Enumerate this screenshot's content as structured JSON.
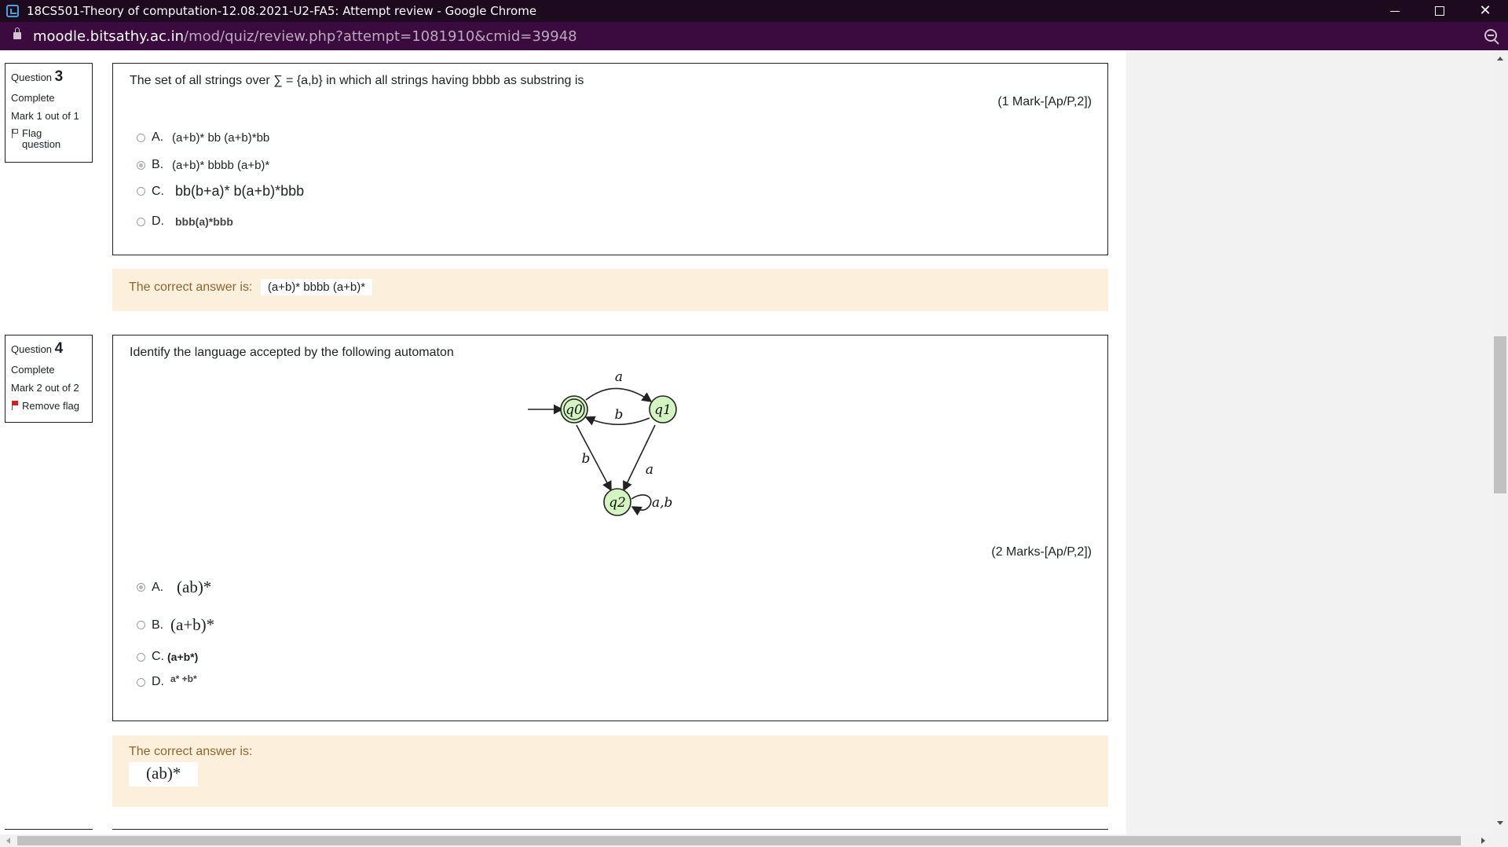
{
  "window": {
    "title": "18CS501-Theory of computation-12.08.2021-U2-FA5: Attempt review - Google Chrome",
    "url_host": "moodle.bitsathy.ac.in",
    "url_path": "/mod/quiz/review.php?attempt=1081910&cmid=39948",
    "minimize_glyph": "",
    "close_glyph": "✕"
  },
  "questions": [
    {
      "label": "Question",
      "number": "3",
      "state": "Complete",
      "mark": "Mark 1 out of 1",
      "flag_label": "Flag question",
      "text": "The set of all strings over ∑ = {a,b} in which all strings having bbbb as substring is",
      "marks_note": "(1 Mark-[Ap/P,2])",
      "options": [
        {
          "letter": "A.",
          "text": "(a+b)* bb (a+b)*bb",
          "checked": false
        },
        {
          "letter": "B.",
          "text": "(a+b)* bbbb (a+b)*",
          "checked": true
        },
        {
          "letter": "C.",
          "text": "bb(b+a)* b(a+b)*bbb",
          "checked": false
        },
        {
          "letter": "D.",
          "text": "bbb(a)*bbb",
          "checked": false
        }
      ],
      "feedback_label": "The correct answer is:",
      "feedback_answer": "(a+b)* bbbb (a+b)*"
    },
    {
      "label": "Question",
      "number": "4",
      "state": "Complete",
      "mark": "Mark 2 out of 2",
      "flag_label": "Remove flag",
      "text": "Identify the language accepted by the following automaton",
      "marks_note": "(2 Marks-[Ap/P,2])",
      "options": [
        {
          "letter": "A.",
          "text": "(ab)*",
          "checked": true
        },
        {
          "letter": "B.",
          "text": "(a+b)*",
          "checked": false
        },
        {
          "letter": "C.",
          "text": "(a+b*)",
          "checked": false
        },
        {
          "letter": "D.",
          "text": "a* +b*",
          "checked": false
        }
      ],
      "feedback_label": "The correct answer is:",
      "feedback_answer": "(ab)*",
      "automaton": {
        "states": [
          "q0",
          "q1",
          "q2"
        ],
        "start_state": "q0",
        "accepting_states": [
          "q0"
        ],
        "transition_labels": {
          "q0_q1": "a",
          "q1_q0": "b",
          "q0_q2": "b",
          "q1_q2": "a",
          "q2_q2": "a,b"
        }
      }
    }
  ],
  "colors": {
    "titlebar": "#1d0a1e",
    "addressbar": "#3b0a3f",
    "feedback_bg": "#fcefdc",
    "feedback_text": "#8e662e",
    "state_fill": "#d4f5c2",
    "flag_red": "#d41e1e"
  }
}
